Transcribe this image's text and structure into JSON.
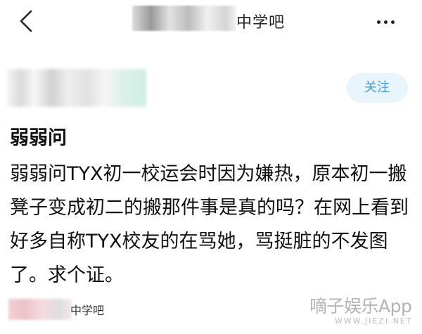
{
  "header": {
    "back_icon": "chevron-left-icon",
    "forum_name_suffix": "中学吧",
    "more_icon": "more-vertical-icon"
  },
  "author": {
    "follow_label": "关注"
  },
  "post": {
    "title": "弱弱问",
    "body": "弱弱问TYX初一校运会时因为嫌热，原本初一搬凳子变成初二的搬那件事是真的吗？在网上看到好多自称TYX校友的在骂她，骂挺脏的不发图了。求个证。"
  },
  "footer": {
    "forum_tag_suffix": "中学吧"
  },
  "watermark": {
    "text": "嘀子娱乐App",
    "sub": "WWW.JIEZI.NET"
  },
  "colors": {
    "accent": "#3f9be0",
    "follow_bg": "#e9f5fd",
    "text": "#111111"
  }
}
